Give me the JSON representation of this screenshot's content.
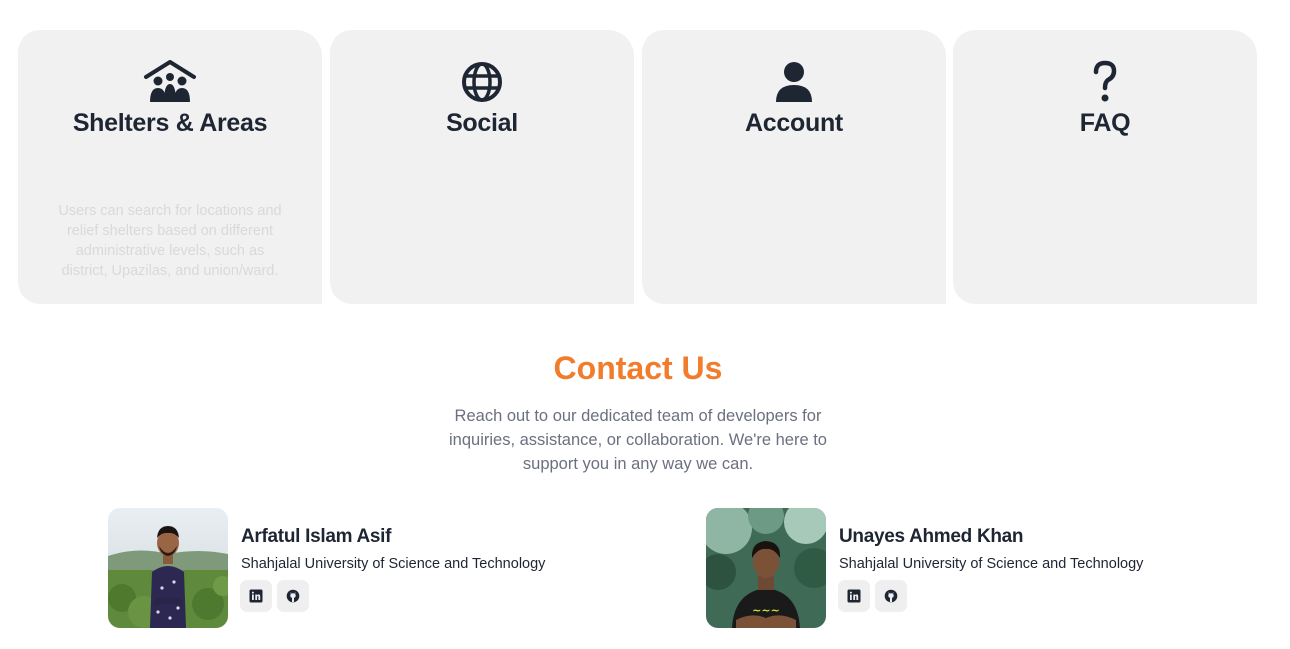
{
  "features": [
    {
      "icon": "family-shelter-icon",
      "title": "Shelters & Areas",
      "description": "Users can search for locations and relief shelters based on different administrative levels, such as district, Upazilas, and union/ward."
    },
    {
      "icon": "globe-icon",
      "title": "Social",
      "description": ""
    },
    {
      "icon": "user-icon",
      "title": "Account",
      "description": ""
    },
    {
      "icon": "question-mark-icon",
      "title": "FAQ",
      "description": ""
    }
  ],
  "contact": {
    "title": "Contact Us",
    "subtitle": "Reach out to our dedicated team of developers for inquiries, assistance, or collaboration. We're here to support you in any way we can.",
    "accent_color": "#f07c2c",
    "members": [
      {
        "name": "Arfatul Islam Asif",
        "university": "Shahjalal University of Science and Technology",
        "links": [
          "linkedin-icon",
          "github-icon"
        ]
      },
      {
        "name": "Unayes Ahmed Khan",
        "university": "Shahjalal University of Science and Technology",
        "links": [
          "linkedin-icon",
          "github-icon"
        ]
      }
    ]
  }
}
